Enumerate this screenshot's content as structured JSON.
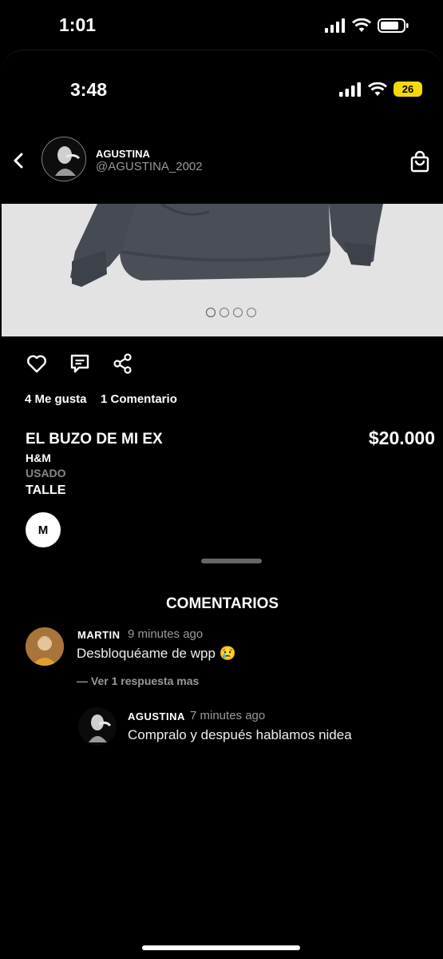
{
  "system_status": {
    "time": "1:01"
  },
  "app_status": {
    "time": "3:48",
    "battery": "26"
  },
  "header": {
    "user_name": "AGUSTINA",
    "user_handle": "@AGUSTINA_2002"
  },
  "carousel": {
    "total_images": 4,
    "active_index": 0
  },
  "stats": {
    "likes": "4 Me gusta",
    "comments": "1 Comentario"
  },
  "product": {
    "title": "EL BUZO DE MI EX",
    "price": "$20.000",
    "brand": "H&M",
    "condition": "USADO",
    "size_label": "TALLE",
    "size_value": "M"
  },
  "comments_section": {
    "title": "COMENTARIOS",
    "comments": [
      {
        "author": "MARTIN",
        "time": "9 minutes ago",
        "text": "Desbloquéame de wpp 😢",
        "replies_link": "— Ver 1 respuesta mas"
      }
    ],
    "reply": {
      "author": "AGUSTINA",
      "time": "7 minutes ago",
      "text": "Compralo y después hablamos nidea"
    }
  },
  "colors": {
    "background": "#000000",
    "battery_badge": "#f5d90a",
    "image_bg": "#e3e3e3"
  }
}
